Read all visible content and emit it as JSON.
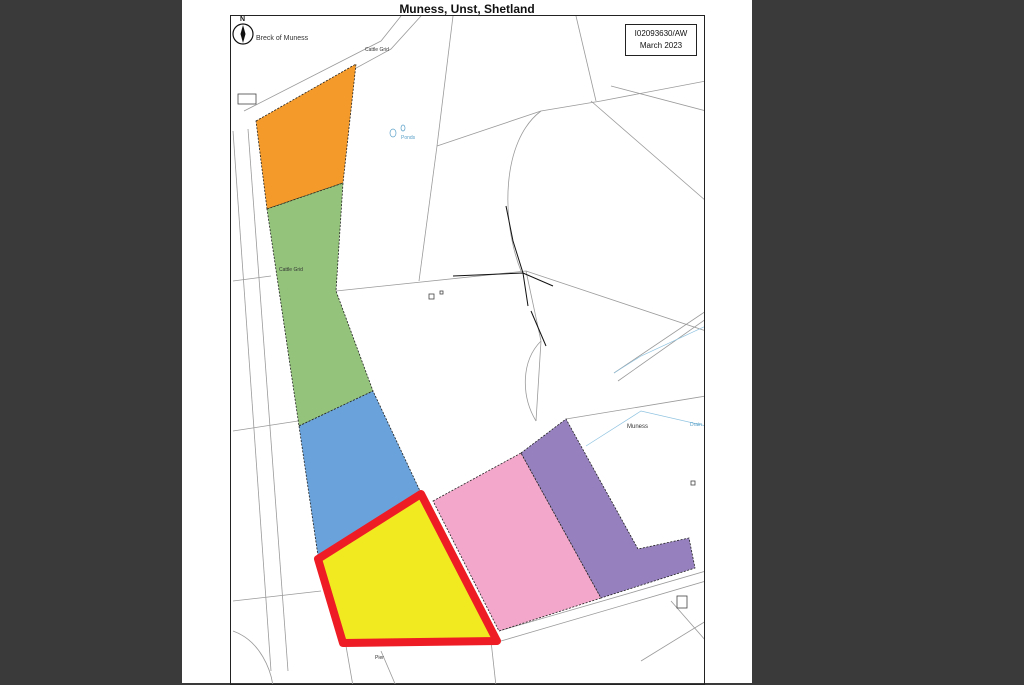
{
  "title": "Muness, Unst, Shetland",
  "reference": {
    "code": "I02093630/AW",
    "date": "March 2023"
  },
  "labels": {
    "breck": "Breck of Muness",
    "cattle_grid_top": "Cattle Grid",
    "cattle_grid_mid": "Cattle Grid",
    "ponds": "Ponds",
    "muness": "Muness",
    "drain": "Drain",
    "pier": "Pier"
  },
  "north_arrow_letter": "N",
  "plots": [
    {
      "name": "orange",
      "color": "#f39a2a"
    },
    {
      "name": "green",
      "color": "#94c47c"
    },
    {
      "name": "blue",
      "color": "#6aa3db"
    },
    {
      "name": "yellow",
      "color": "#f1ea21",
      "outline": "#ee1c24"
    },
    {
      "name": "pink",
      "color": "#f3a8cb"
    },
    {
      "name": "purple",
      "color": "#9681be"
    }
  ]
}
